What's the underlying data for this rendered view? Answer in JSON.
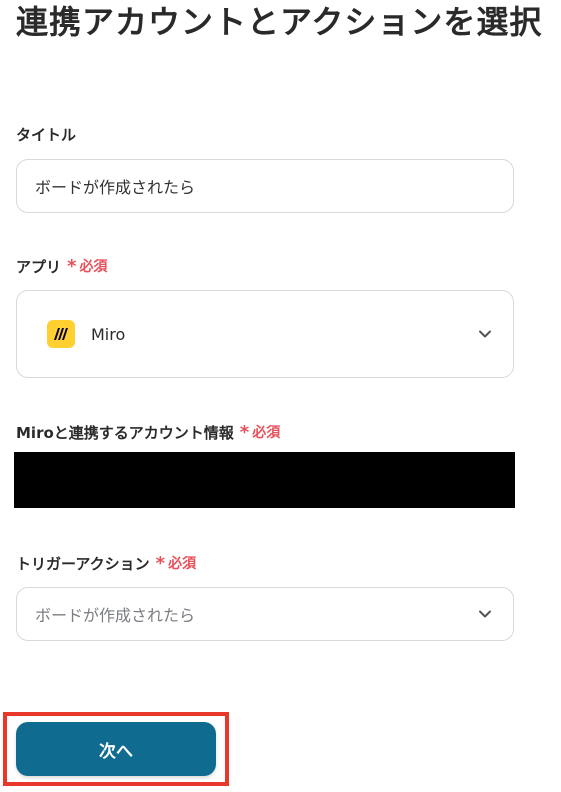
{
  "page": {
    "title": "連携アカウントとアクションを選択"
  },
  "required_text": "必須",
  "title_field": {
    "label": "タイトル",
    "value": "ボードが作成されたら"
  },
  "app_field": {
    "label": "アプリ",
    "selected_app": "Miro",
    "app_icon": "miro-logo-icon"
  },
  "account_field": {
    "label": "Miroと連携するアカウント情報"
  },
  "trigger_field": {
    "label": "トリガーアクション",
    "selected_value": "ボードが作成されたら"
  },
  "actions": {
    "next_label": "次へ"
  },
  "colors": {
    "accent": "#0f6b8f",
    "required": "#e8505b",
    "highlight": "#e8382a",
    "miro_yellow": "#ffd02f"
  }
}
